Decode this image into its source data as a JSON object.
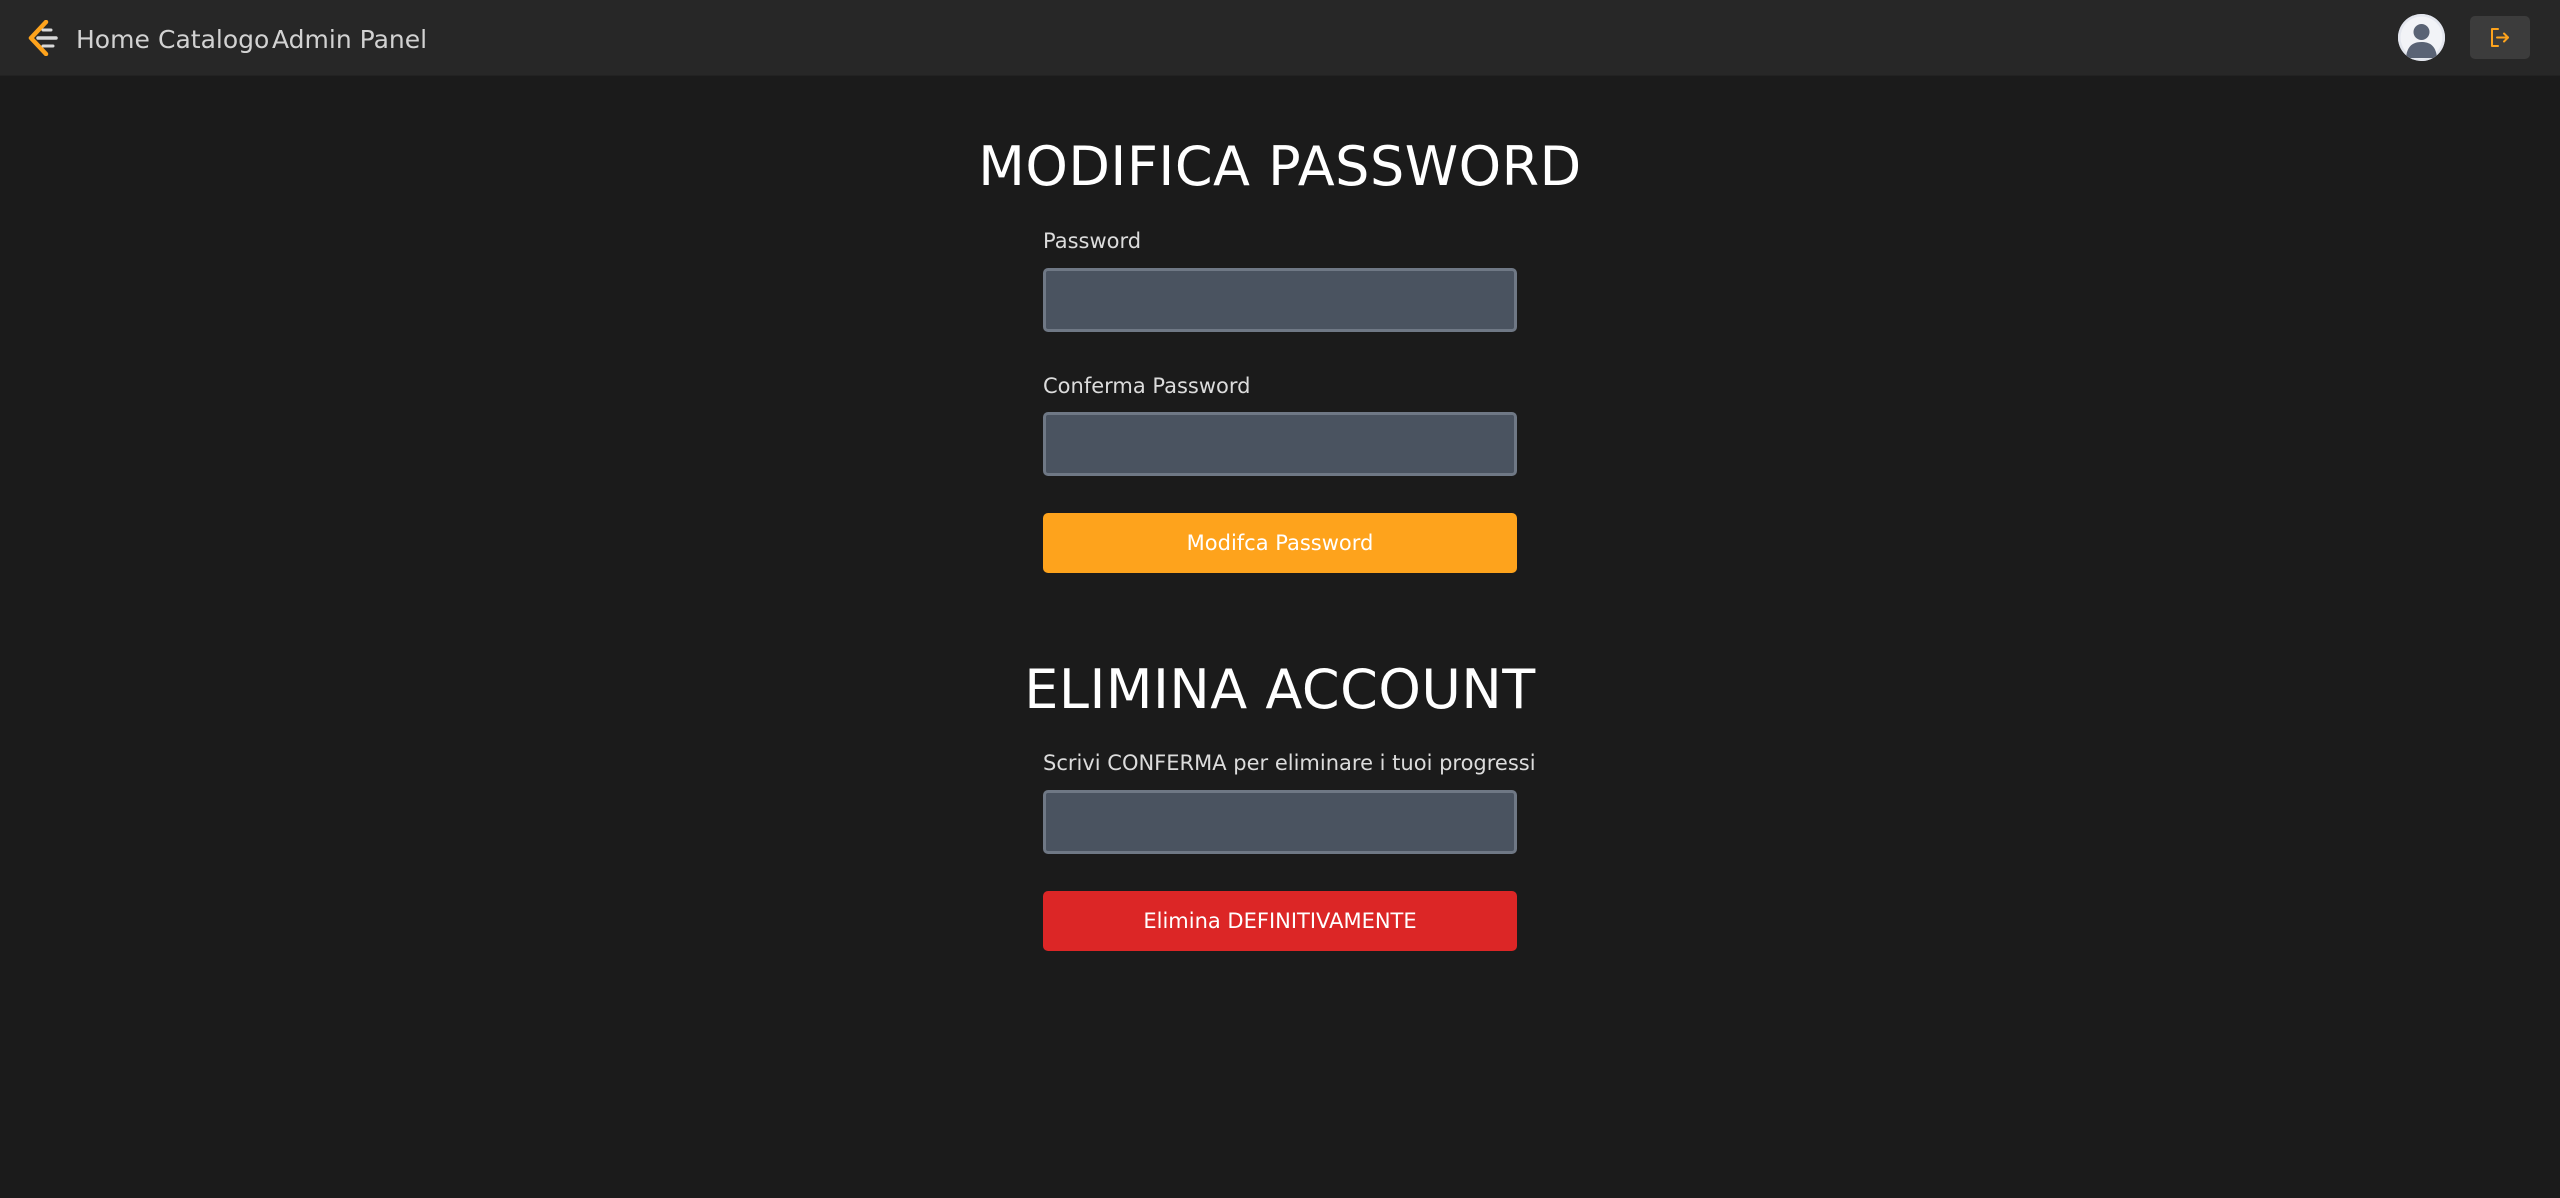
{
  "navbar": {
    "logo_icon": "code-bracket-logo-icon",
    "links": [
      {
        "label": "Home"
      },
      {
        "label": "Catalogo"
      },
      {
        "label": "Admin Panel"
      }
    ],
    "avatar_icon": "user-avatar-icon",
    "logout_icon": "logout-icon"
  },
  "password_section": {
    "title": "MODIFICA PASSWORD",
    "password_label": "Password",
    "password_value": "",
    "confirm_label": "Conferma Password",
    "confirm_value": "",
    "submit_label": "Modifca Password"
  },
  "delete_section": {
    "title": "ELIMINA ACCOUNT",
    "confirm_label": "Scrivi CONFERMA per eliminare i tuoi progressi",
    "confirm_value": "",
    "submit_label": "Elimina DEFINITIVAMENTE"
  },
  "colors": {
    "background": "#1b1b1b",
    "navbar": "#272727",
    "accent": "#fea31c",
    "danger": "#dc2626",
    "input_bg": "#4a5360"
  }
}
